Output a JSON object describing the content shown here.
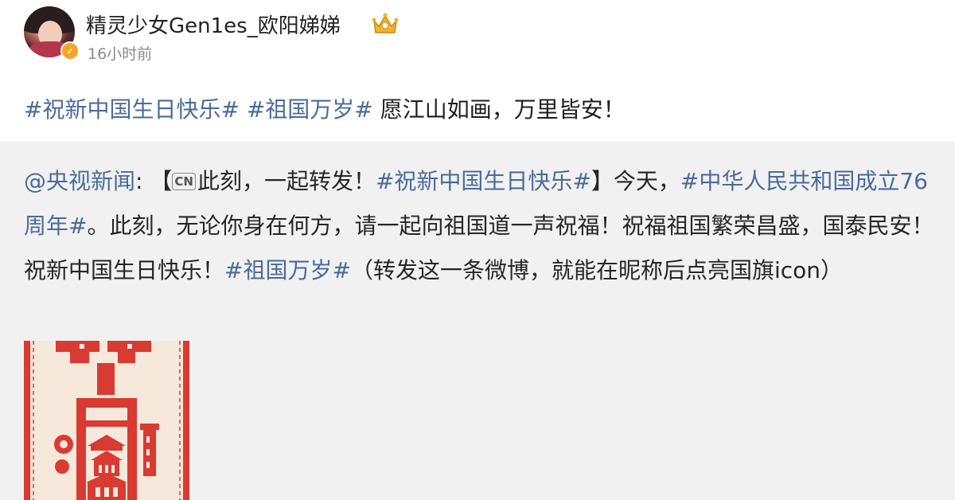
{
  "header": {
    "username": "精灵少女Gen1es_欧阳娣娣",
    "timestamp": "16小时前",
    "verified_badge_icon": "verified-v-icon",
    "member_badge_icon": "crown-badge-icon"
  },
  "post": {
    "tag1": "#祝新中国生日快乐#",
    "tag2": "#祖国万岁#",
    "text": "愿江山如画，万里皆安！"
  },
  "repost": {
    "mention": "@央视新闻",
    "colon": ": ",
    "open_bracket": "【",
    "cn_icon_label": "CN",
    "text1": "此刻，一起转发！",
    "tag1": "#祝新中国生日快乐#",
    "text2": "】今天，",
    "tag2": "#中华人民共和国成立76周年#",
    "text3": "。此刻，无论你身在何方，请一起向祖国道一声祝福！祝福祖国繁荣昌盛，国泰民安！祝新中国生日快乐！",
    "tag3": "#祖国万岁#",
    "text4": "（转发这一条微博，就能在昵称后点亮国旗icon）"
  },
  "colors": {
    "link_blue": "#4a6b9a",
    "repost_background": "#f1f1f1",
    "papercut_red": "#d93a32"
  }
}
